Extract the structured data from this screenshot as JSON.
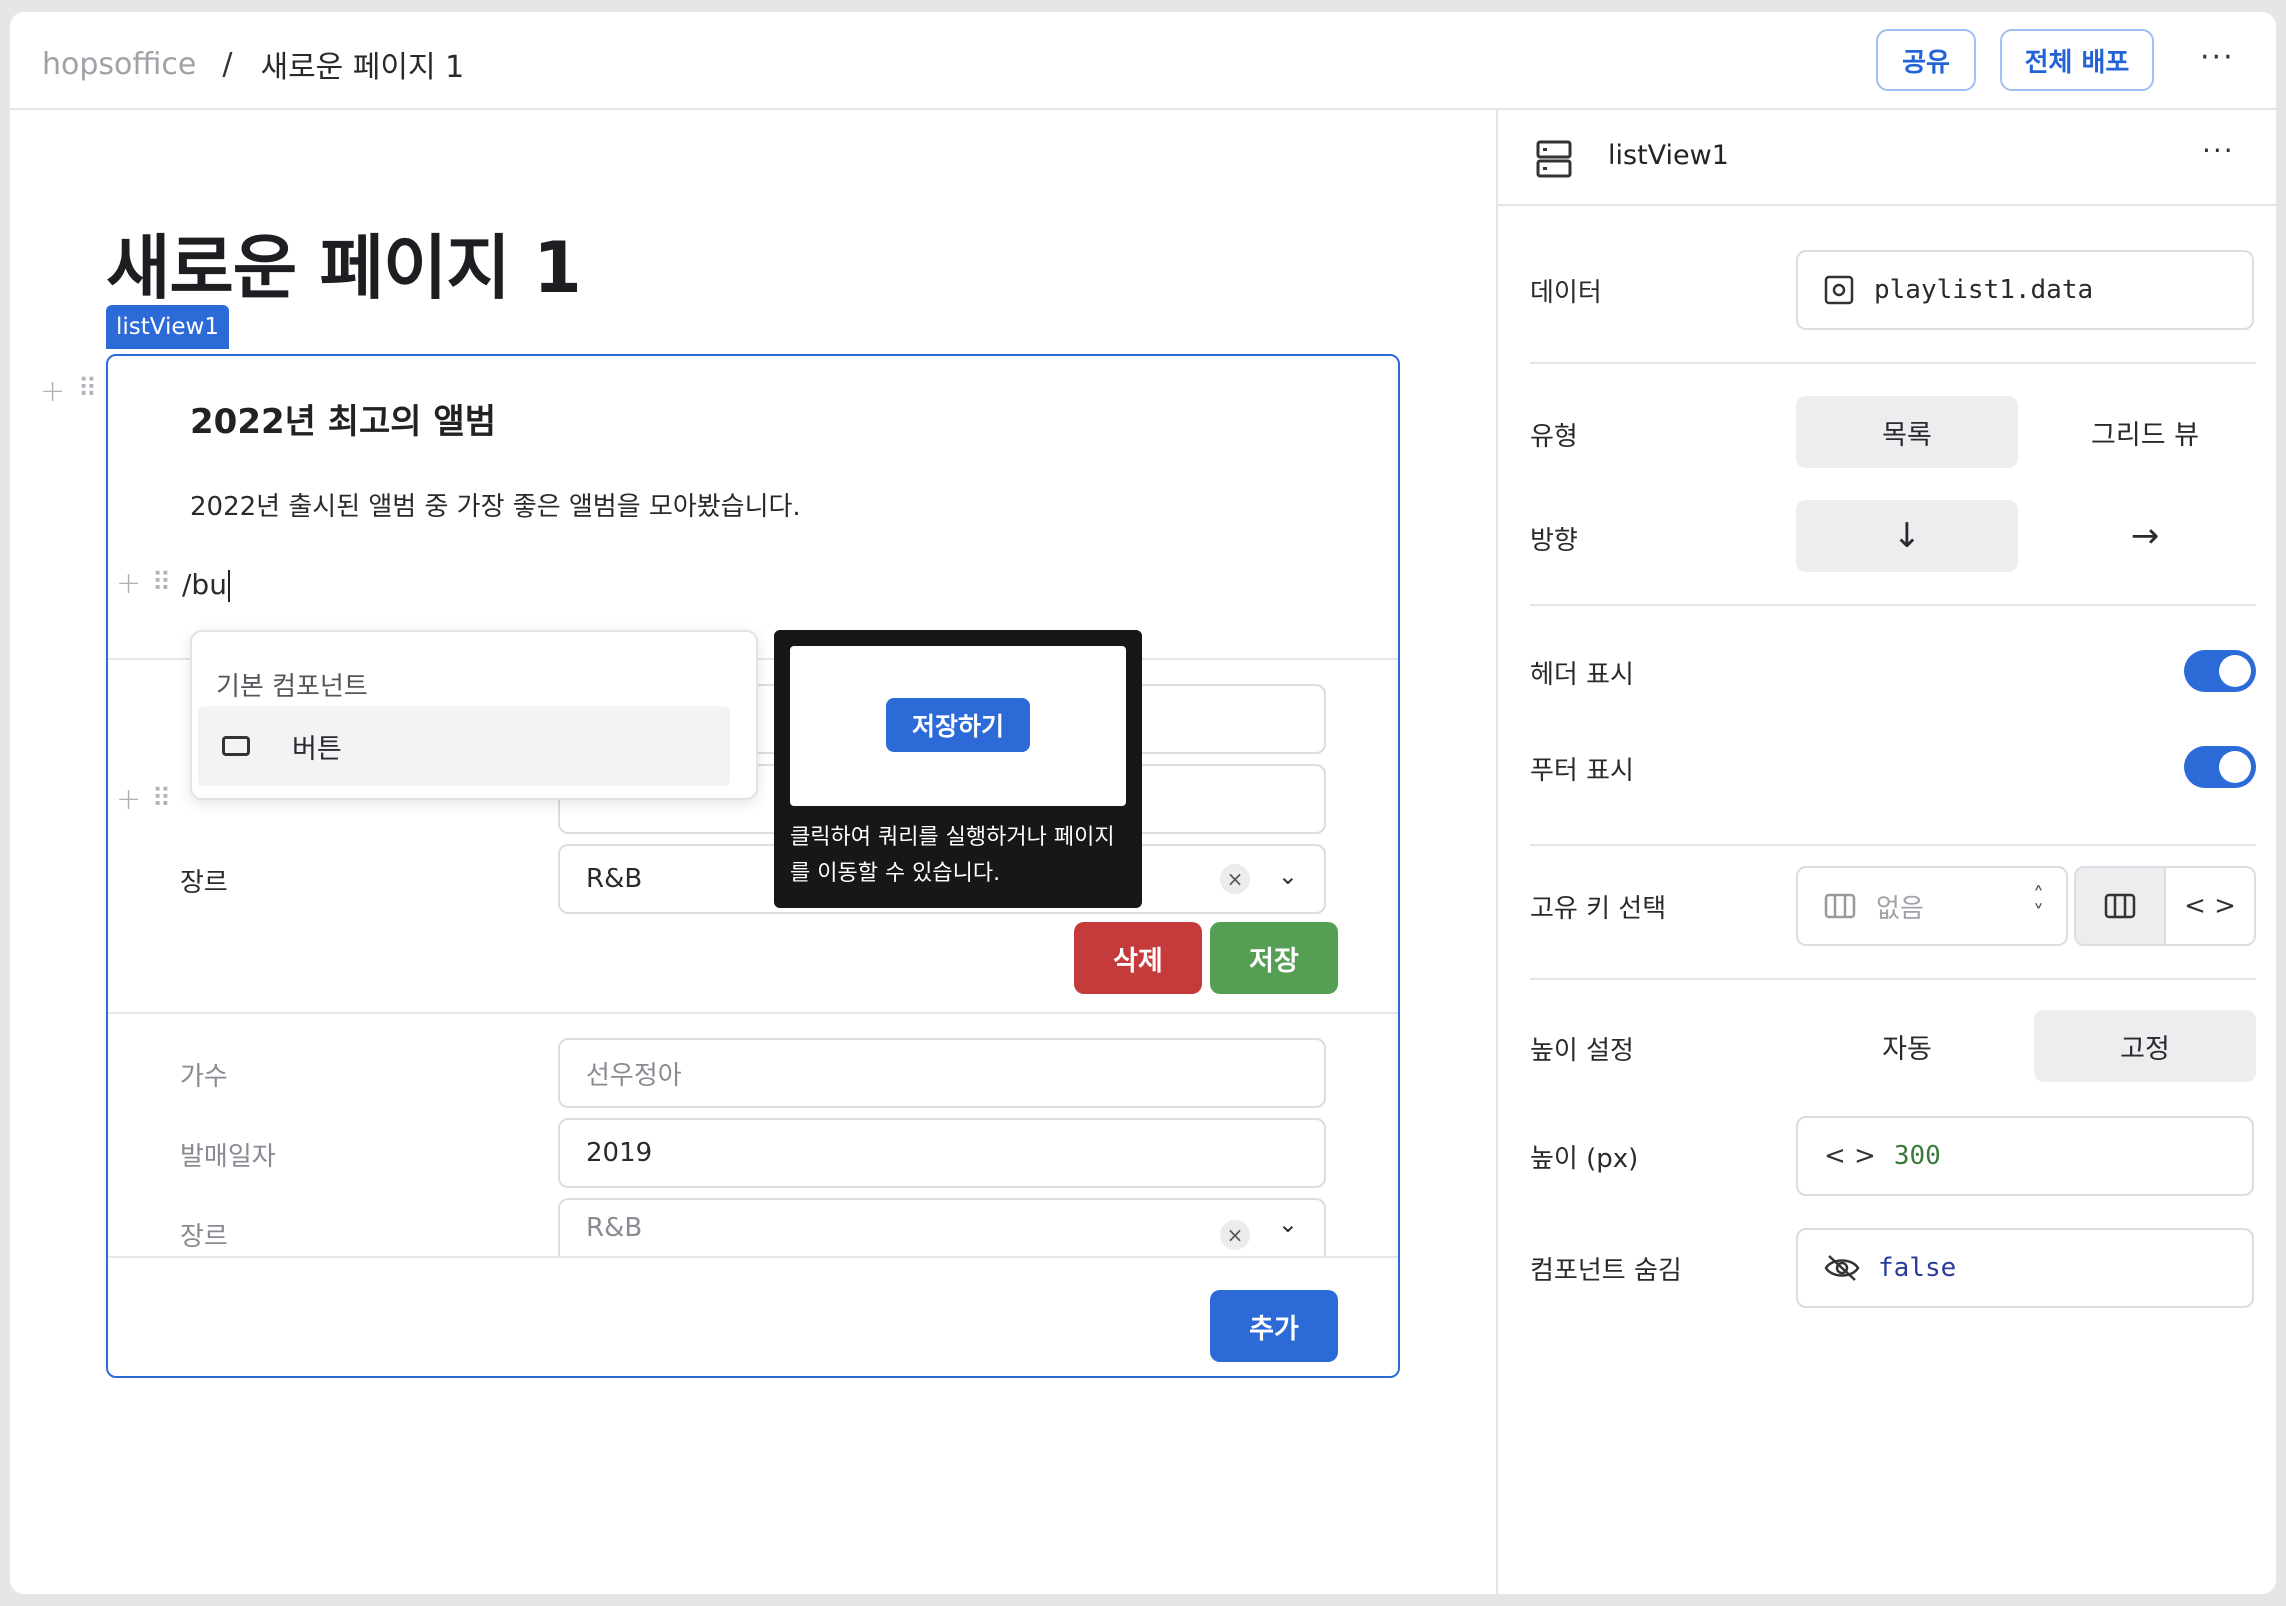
{
  "breadcrumb": {
    "root": "hopsoffice",
    "separator": "/",
    "page": "새로운 페이지 1"
  },
  "header": {
    "share_label": "공유",
    "deploy_label": "전체 배포",
    "more_label": "···"
  },
  "page": {
    "title": "새로운 페이지 1",
    "component_tag": "listView1"
  },
  "listview": {
    "title": "2022년 최고의 앨범",
    "description": "2022년 출시된 앨범 중 가장 좋은 앨범을 모아봤습니다.",
    "slash_input": "/bu",
    "item1": {
      "genre_label": "장르",
      "genre_value": "R&B",
      "delete_label": "삭제",
      "save_label": "저장"
    },
    "item2": {
      "artist_label": "가수",
      "artist_value": "선우정아",
      "date_label": "발매일자",
      "date_value": "2019",
      "genre_label": "장르",
      "genre_value": "R&B"
    },
    "add_label": "추가"
  },
  "component_menu": {
    "section": "기본 컴포넌트",
    "items": [
      {
        "label": "버튼",
        "icon": "button-icon"
      }
    ]
  },
  "tooltip": {
    "preview_button": "저장하기",
    "description": "클릭하여 쿼리를 실행하거나 페이지를 이동할 수 있습니다."
  },
  "inspector": {
    "component_name": "listView1",
    "more_label": "···",
    "data_label": "데이터",
    "data_value": "playlist1.data",
    "type_label": "유형",
    "type_options": [
      "목록",
      "그리드 뷰"
    ],
    "type_selected": "목록",
    "direction_label": "방향",
    "direction_options": [
      "↓",
      "→"
    ],
    "header_label": "헤더 표시",
    "header_on": true,
    "footer_label": "푸터 표시",
    "footer_on": true,
    "key_label": "고유 키 선택",
    "key_value": "없음",
    "height_mode_label": "높이 설정",
    "height_mode_options": [
      "자동",
      "고정"
    ],
    "height_mode_selected": "고정",
    "height_label": "높이 (px)",
    "height_value": "300",
    "hidden_label": "컴포넌트 숨김",
    "hidden_value": "false"
  },
  "colors": {
    "accent": "#2c6ad8",
    "danger": "#c53a3a",
    "success": "#559f55"
  }
}
